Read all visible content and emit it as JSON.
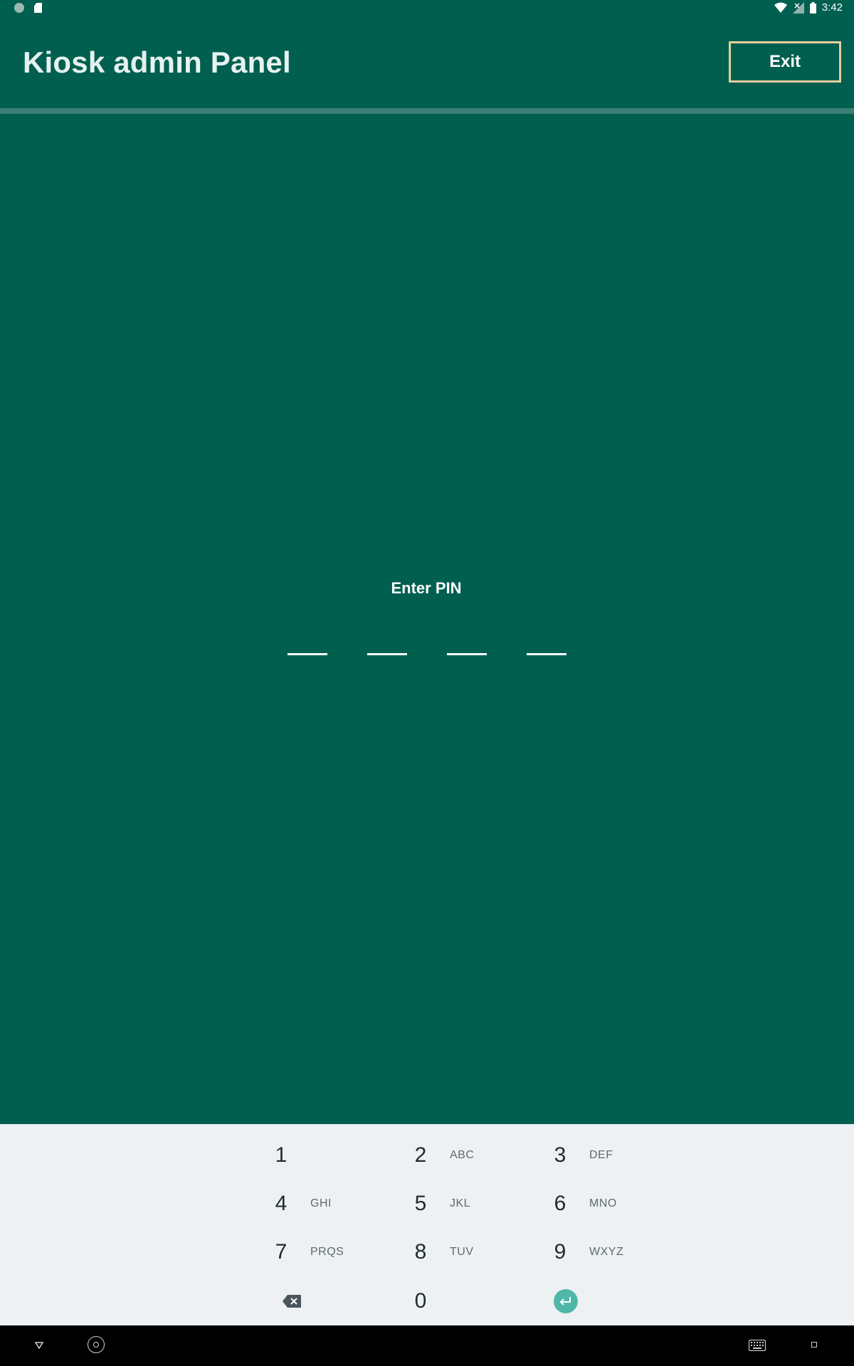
{
  "status_bar": {
    "time": "3:42",
    "left_icons": [
      "notification-dot-icon",
      "sd-card-icon"
    ],
    "right_icons": [
      "wifi-icon",
      "signal-no-service-icon",
      "battery-icon"
    ]
  },
  "header": {
    "title": "Kiosk admin Panel",
    "exit_label": "Exit"
  },
  "pin": {
    "label": "Enter PIN",
    "slots": [
      "",
      "",
      "",
      ""
    ]
  },
  "keypad": {
    "keys": [
      {
        "digit": "1",
        "letters": ""
      },
      {
        "digit": "2",
        "letters": "ABC"
      },
      {
        "digit": "3",
        "letters": "DEF"
      },
      {
        "digit": "4",
        "letters": "GHI"
      },
      {
        "digit": "5",
        "letters": "JKL"
      },
      {
        "digit": "6",
        "letters": "MNO"
      },
      {
        "digit": "7",
        "letters": "PRQS"
      },
      {
        "digit": "8",
        "letters": "TUV"
      },
      {
        "digit": "9",
        "letters": "WXYZ"
      },
      {
        "digit": "0",
        "letters": ""
      }
    ],
    "backspace_icon": "backspace-icon",
    "enter_icon": "enter-icon"
  },
  "nav_bar": {
    "icons": [
      "back-icon",
      "home-icon",
      "keyboard-icon",
      "recents-icon"
    ]
  },
  "colors": {
    "background": "#015f50",
    "exit_border": "#e3cf9c",
    "keypad_background": "#edf1f3",
    "enter_accent": "#4fb7a8"
  }
}
